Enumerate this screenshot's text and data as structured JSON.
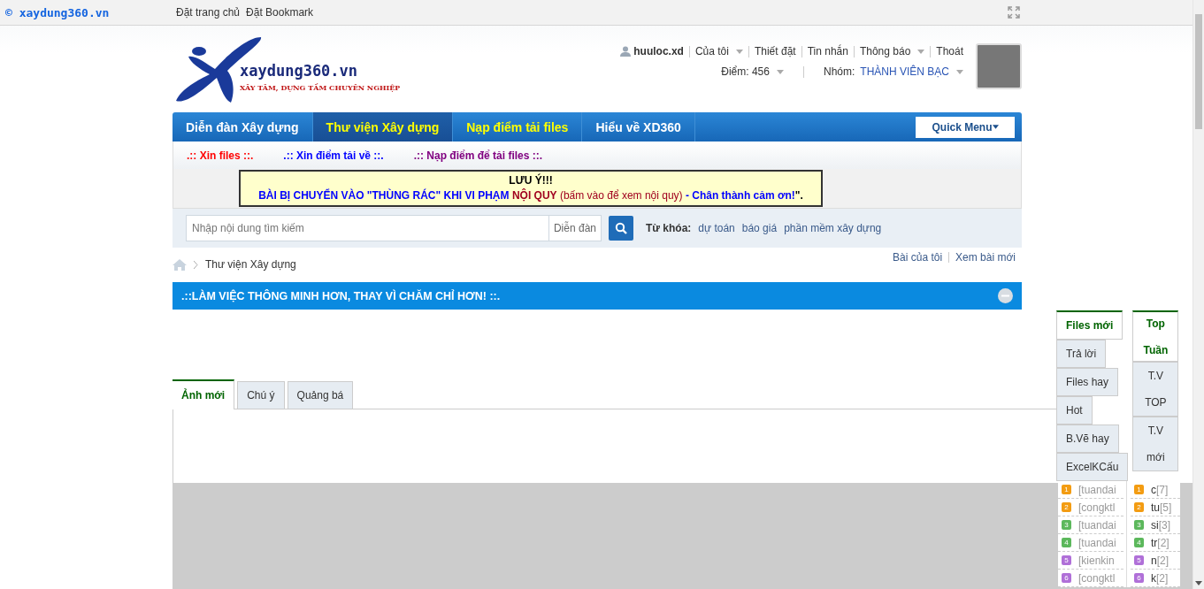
{
  "top_bar": {
    "brand": "© xaydung360.vn",
    "links": [
      "Đặt trang chủ",
      "Đặt Bookmark"
    ]
  },
  "logo": {
    "name": "xaydung360.vn",
    "tagline": "XÂY TÂM, DỰNG TẦM CHUYÊN NGHIỆP"
  },
  "user_menu": {
    "username": "huuloc.xd",
    "items": [
      {
        "label": "Của tôi",
        "dropdown": true
      },
      {
        "label": "Thiết đặt",
        "dropdown": false
      },
      {
        "label": "Tin nhắn",
        "dropdown": false
      },
      {
        "label": "Thông báo",
        "dropdown": true
      },
      {
        "label": "Thoát",
        "dropdown": false
      }
    ],
    "points": "Điểm: 456",
    "group_label": "Nhóm:",
    "group": "THÀNH VIÊN BẠC"
  },
  "nav": {
    "items": [
      {
        "label": "Diễn đàn Xây dựng",
        "selected": false,
        "highlighted": false
      },
      {
        "label": "Thư viện Xây dựng",
        "selected": true,
        "highlighted": true
      },
      {
        "label": "Nạp điểm tải files",
        "selected": false,
        "highlighted": true
      },
      {
        "label": "Hiểu về XD360",
        "selected": false,
        "highlighted": false
      }
    ],
    "quick_menu": "Quick Menu"
  },
  "quick_links": [
    {
      "label": ".:: Xin files ::.",
      "color": "#ff0000"
    },
    {
      "label": ".:: Xin điểm tải về ::.",
      "color": "#0000ff"
    },
    {
      "label": ".:: Nạp điểm để tải files ::.",
      "color": "#800080"
    }
  ],
  "notice": {
    "title": "LƯU Ý!!!",
    "segments": [
      {
        "text": "BÀI BỊ CHUYỂN VÀO \"THÙNG RÁC\" KHI VI PHẠM ",
        "color": "#0000ff"
      },
      {
        "text": "NỘI QUY",
        "color": "#a0001e"
      },
      {
        "text": " (bấm vào để xem nội quy)",
        "color": "#a0001e"
      },
      {
        "text": " - Chân thành cảm ơn!",
        "color": "#0000ff"
      },
      {
        "text": "\"."
      }
    ]
  },
  "search": {
    "placeholder": "Nhập nội dung tìm kiếm",
    "scope": "Diễn đàn",
    "keywords_label": "Từ khóa:",
    "keywords": [
      "dự toán",
      "báo giá",
      "phần mềm xây dựng"
    ]
  },
  "breadcrumb": {
    "items": [
      "Thư viện Xây dựng"
    ],
    "links": [
      "Bài của tôi",
      "Xem bài mới"
    ]
  },
  "panel": {
    "title": ".::LÀM VIỆC THÔNG MINH HƠN, THAY VÌ CHĂM CHỈ HƠN! ::.",
    "tabs": [
      {
        "label": "Ảnh mới",
        "selected": true
      },
      {
        "label": "Chú ý",
        "selected": false
      },
      {
        "label": "Quảng bá",
        "selected": false
      }
    ]
  },
  "side_widget": {
    "left_tabs": [
      {
        "label": "Files mới",
        "selected": true
      },
      {
        "label": "Trả lời",
        "selected": false
      },
      {
        "label": "Files hay",
        "selected": false
      },
      {
        "label": "Hot",
        "selected": false
      },
      {
        "label": "B.Vẽ hay",
        "selected": false
      },
      {
        "label": "ExcelKCấu",
        "selected": false
      }
    ],
    "right_tabs": [
      {
        "label": "Top Tuần",
        "selected": true
      },
      {
        "label": "T.V TOP",
        "selected": false
      },
      {
        "label": "T.V mới",
        "selected": false
      }
    ],
    "left_list": [
      {
        "rank": "1",
        "text": "[tuandai",
        "color": "#f39c12"
      },
      {
        "rank": "2",
        "text": "[congktl",
        "color": "#f39c12"
      },
      {
        "rank": "3",
        "text": "[tuandai",
        "color": "#5cb85c"
      },
      {
        "rank": "4",
        "text": "[tuandai",
        "color": "#5cb85c"
      },
      {
        "rank": "5",
        "text": "[kienkin",
        "color": "#b070d8"
      },
      {
        "rank": "6",
        "text": "[congktl",
        "color": "#b070d8"
      }
    ],
    "right_list": [
      {
        "rank": "1",
        "name": "c",
        "count": "[7]",
        "color": "#f39c12"
      },
      {
        "rank": "2",
        "name": "tu",
        "count": "[5]",
        "color": "#f39c12"
      },
      {
        "rank": "3",
        "name": "si",
        "count": "[3]",
        "color": "#5cb85c"
      },
      {
        "rank": "4",
        "name": "tr",
        "count": "[2]",
        "color": "#5cb85c"
      },
      {
        "rank": "5",
        "name": "n",
        "count": "[2]",
        "color": "#b070d8"
      },
      {
        "rank": "6",
        "name": "k",
        "count": "[2]",
        "color": "#b070d8"
      }
    ]
  }
}
